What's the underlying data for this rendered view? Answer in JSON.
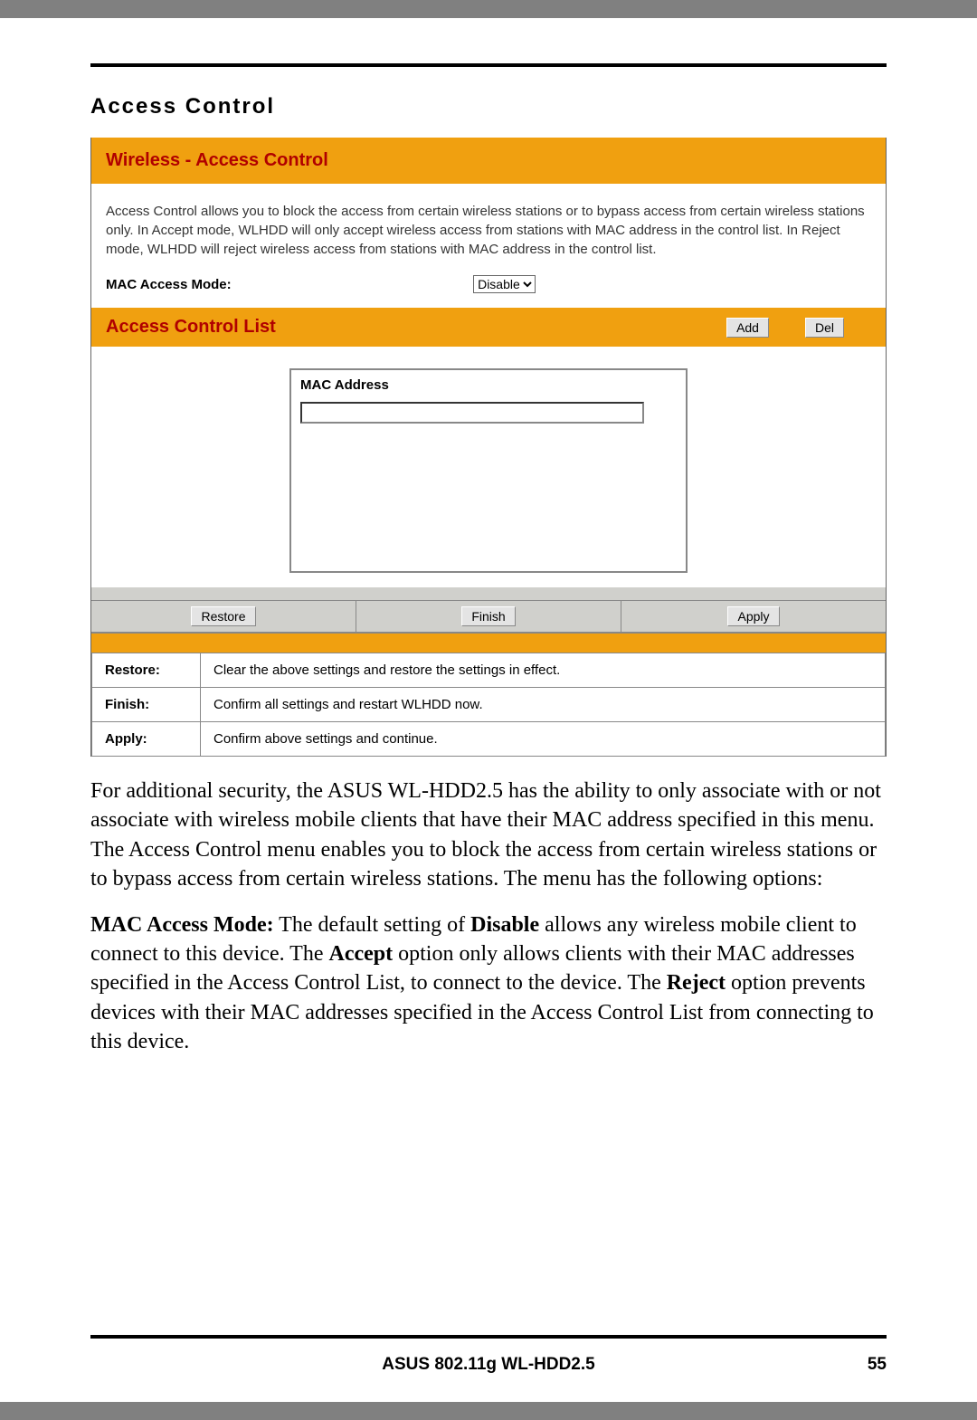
{
  "section_title": "Access Control",
  "panel": {
    "header": "Wireless - Access Control",
    "description": "Access Control allows you to block the access from certain wireless stations or to bypass access from certain wireless stations only. In Accept mode, WLHDD will only accept wireless access from stations with MAC address in the control list. In Reject mode, WLHDD will reject wireless access from stations with MAC address in the control list.",
    "mode_label": "MAC Access Mode:",
    "mode_value": "Disable"
  },
  "acl": {
    "header": "Access Control List",
    "add_btn": "Add",
    "del_btn": "Del",
    "col_header": "MAC Address",
    "input_value": ""
  },
  "actions": {
    "restore": "Restore",
    "finish": "Finish",
    "apply": "Apply"
  },
  "defs": {
    "restore_label": "Restore:",
    "restore_desc": "Clear the above settings and restore the settings in effect.",
    "finish_label": "Finish:",
    "finish_desc": "Confirm all settings and restart WLHDD now.",
    "apply_label": "Apply:",
    "apply_desc": "Confirm above settings and continue."
  },
  "body": {
    "para1": "For additional security, the ASUS WL-HDD2.5 has the ability to only associate with or not associate with wireless mobile clients that have their MAC address specified in this menu. The Access Control menu enables you to block the access from certain wireless stations or to bypass access from certain wireless stations. The menu has the following options:",
    "p2_bold1": "MAC Access Mode:",
    "p2_txt1": " The default setting of ",
    "p2_bold2": "Disable",
    "p2_txt2": " allows any wireless mobile client to connect to this device. The ",
    "p2_bold3": "Accept",
    "p2_txt3": " option only allows clients with their MAC addresses specified in the Access Control List, to connect to the device. The ",
    "p2_bold4": "Reject",
    "p2_txt4": " option prevents devices with their MAC addresses specified in the Access Control List from connecting to this device."
  },
  "footer": {
    "product": "ASUS 802.11g WL-HDD2.5",
    "page": "55"
  }
}
